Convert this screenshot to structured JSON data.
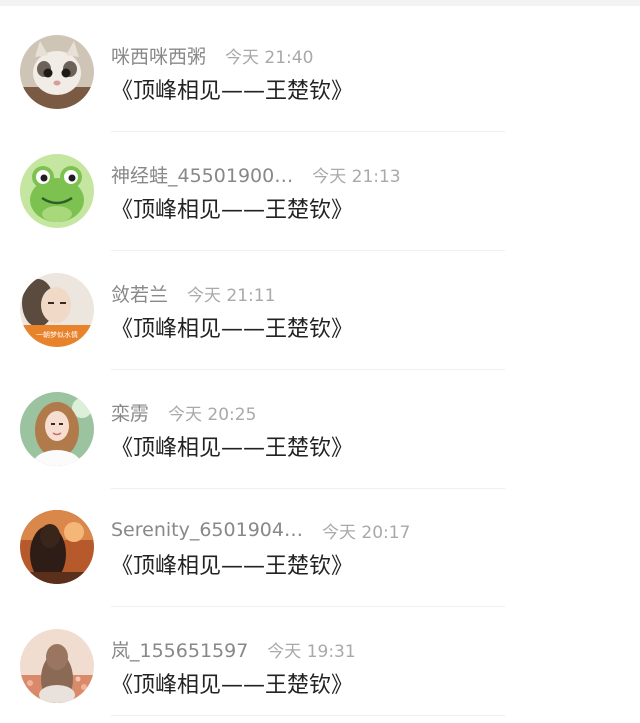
{
  "comments": [
    {
      "username": "咪西咪西粥",
      "time": "今天 21:40",
      "text": "《顶峰相见——王楚钦》",
      "avatar": "cat-avatar"
    },
    {
      "username": "神经蛙_45501900…",
      "time": "今天 21:13",
      "text": "《顶峰相见——王楚钦》",
      "avatar": "frog-avatar"
    },
    {
      "username": "敛若兰",
      "time": "今天 21:11",
      "text": "《顶峰相见——王楚钦》",
      "avatar": "woman-photo-avatar"
    },
    {
      "username": "栾雳",
      "time": "今天 20:25",
      "text": "《顶峰相见——王楚钦》",
      "avatar": "woman-portrait-avatar"
    },
    {
      "username": "Serenity_6501904…",
      "time": "今天 20:17",
      "text": "《顶峰相见——王楚钦》",
      "avatar": "sunset-silhouette-avatar"
    },
    {
      "username": "岚_155651597",
      "time": "今天 19:31",
      "text": "《顶峰相见——王楚钦》",
      "avatar": "flower-field-avatar"
    }
  ],
  "avatar_badge_text": "一朝梦似水情",
  "colors": {
    "username": "#888888",
    "time": "#a9a9a9",
    "message": "#222222",
    "divider": "#efefef"
  }
}
